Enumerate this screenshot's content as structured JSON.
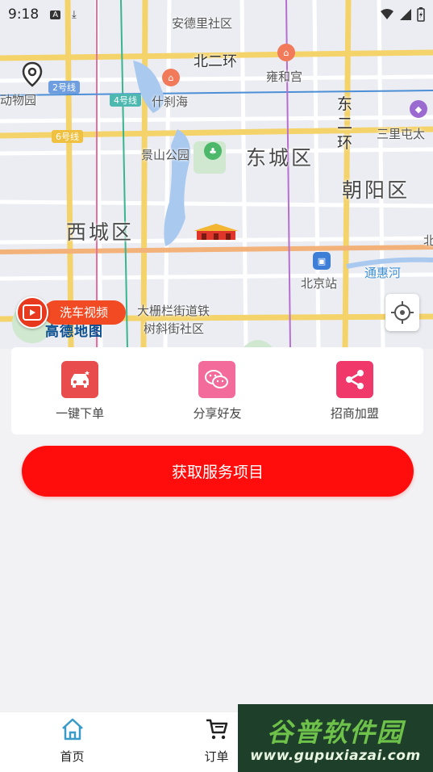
{
  "status_bar": {
    "time": "9:18"
  },
  "map": {
    "labels": {
      "anderli": "安德里社区",
      "beierhuan": "北二环",
      "yonghegong": "雍和宫",
      "shichahai": "什刹海",
      "dong": "东",
      "er": "二",
      "huan": "环",
      "sanlitun": "三里屯太",
      "jingshan": "景山公园",
      "dongcheng": "东城区",
      "chaoyang": "朝阳区",
      "xicheng": "西城区",
      "bei": "北",
      "beijingzhan": "北京站",
      "tonghuihe": "通惠河",
      "dashilan": "大栅栏街道铁",
      "shuxie": "树斜街社区",
      "zoo": "动物园",
      "line2": "2号线",
      "line4": "4号线",
      "line6": "6号线"
    },
    "amap_logo": "高德地图",
    "video_button_label": "洗车视频"
  },
  "actions": [
    {
      "label": "一键下单",
      "icon": "car-wash-icon",
      "color": "#e84c4c"
    },
    {
      "label": "分享好友",
      "icon": "wechat-icon",
      "color": "#f26b9a"
    },
    {
      "label": "招商加盟",
      "icon": "share-icon",
      "color": "#f0386a"
    }
  ],
  "cta_label": "获取服务项目",
  "tabs": [
    {
      "label": "首页",
      "icon": "home-icon",
      "active": true
    },
    {
      "label": "订单",
      "icon": "cart-icon",
      "active": false
    }
  ],
  "watermark": {
    "title": "谷普软件园",
    "url": "www.gupuxiazai.com"
  },
  "colors": {
    "accent": "#ff0d0d",
    "home_icon": "#3a9bc9"
  }
}
